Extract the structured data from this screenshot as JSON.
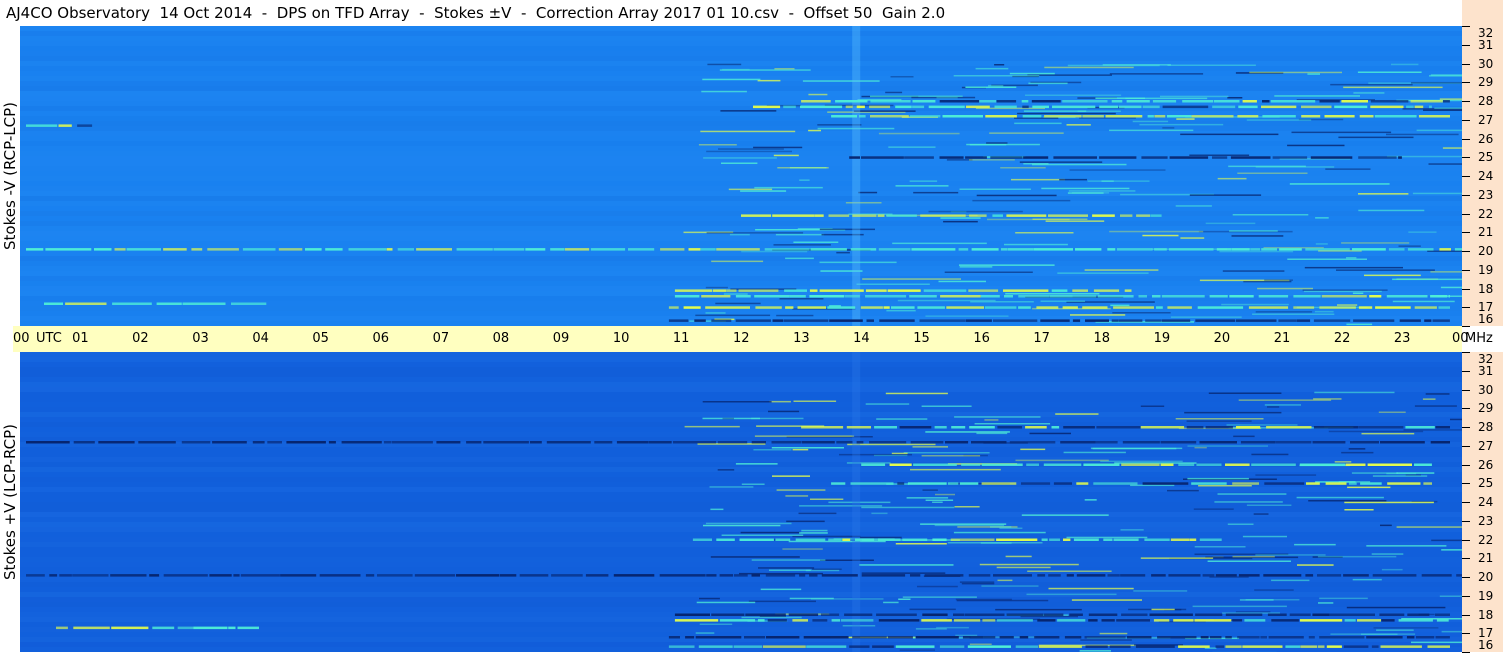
{
  "title": "AJ4CO Observatory  14 Oct 2014  -  DPS on TFD Array  -  Stokes ±V  -  Correction Array 2017 01 10.csv  -  Offset 50  Gain 2.0",
  "colors": {
    "utc_band": "#ffffc0",
    "freq_strip": "#fde3cc",
    "panel_top_base": "#1a82f0",
    "panel_bottom_base": "#1260dc",
    "signal_bright": "#e6ff4a",
    "signal_mid": "#4ff0d6",
    "signal_dark": "#06246e"
  },
  "chart_data": {
    "type": "heatmap",
    "x_axis": {
      "unit_label": "UTC",
      "ticks": [
        "00",
        "01",
        "02",
        "03",
        "04",
        "05",
        "06",
        "07",
        "08",
        "09",
        "10",
        "11",
        "12",
        "13",
        "14",
        "15",
        "16",
        "17",
        "18",
        "19",
        "20",
        "21",
        "22",
        "23",
        "00"
      ],
      "range_hours": [
        0,
        24
      ]
    },
    "y_axis": {
      "unit_label": "MHz",
      "ticks": [
        "32",
        "31",
        "30",
        "29",
        "28",
        "27",
        "26",
        "25",
        "24",
        "23",
        "22",
        "21",
        "20",
        "19",
        "18",
        "17",
        "16"
      ],
      "range_mhz": [
        16,
        32
      ]
    },
    "panels": [
      {
        "label": "Stokes -V (RCP-LCP)",
        "tone": "light",
        "bands": [
          {
            "mhz": 28.0,
            "start": 13.0,
            "end": 23.8,
            "style": "mixed"
          },
          {
            "mhz": 27.7,
            "start": 12.2,
            "end": 23.5,
            "style": "mixed"
          },
          {
            "mhz": 27.2,
            "start": 13.5,
            "end": 23.8,
            "style": "bright"
          },
          {
            "mhz": 26.7,
            "start": 0.1,
            "end": 1.2,
            "style": "mixed"
          },
          {
            "mhz": 25.0,
            "start": 13.8,
            "end": 23.0,
            "style": "dark"
          },
          {
            "mhz": 21.9,
            "start": 12.0,
            "end": 19.0,
            "style": "bright"
          },
          {
            "mhz": 20.1,
            "start": 0.1,
            "end": 24.0,
            "style": "mid"
          },
          {
            "mhz": 17.9,
            "start": 10.9,
            "end": 18.5,
            "style": "bright"
          },
          {
            "mhz": 17.6,
            "start": 10.9,
            "end": 23.8,
            "style": "mid"
          },
          {
            "mhz": 17.2,
            "start": 0.4,
            "end": 4.1,
            "style": "mid"
          },
          {
            "mhz": 17.0,
            "start": 10.8,
            "end": 23.8,
            "style": "bright"
          },
          {
            "mhz": 16.3,
            "start": 10.8,
            "end": 23.8,
            "style": "dark"
          }
        ]
      },
      {
        "label": "Stokes +V (LCP-RCP)",
        "tone": "dark",
        "bands": [
          {
            "mhz": 28.0,
            "start": 13.0,
            "end": 23.8,
            "style": "mixed"
          },
          {
            "mhz": 27.2,
            "start": 0.1,
            "end": 23.8,
            "style": "dark"
          },
          {
            "mhz": 26.0,
            "start": 14.0,
            "end": 23.5,
            "style": "mid"
          },
          {
            "mhz": 25.0,
            "start": 13.5,
            "end": 23.5,
            "style": "mixed"
          },
          {
            "mhz": 22.0,
            "start": 11.2,
            "end": 20.0,
            "style": "mid"
          },
          {
            "mhz": 20.1,
            "start": 0.1,
            "end": 24.0,
            "style": "dark"
          },
          {
            "mhz": 18.0,
            "start": 10.9,
            "end": 23.8,
            "style": "dark"
          },
          {
            "mhz": 17.7,
            "start": 10.9,
            "end": 23.8,
            "style": "mixed"
          },
          {
            "mhz": 17.3,
            "start": 0.6,
            "end": 4.0,
            "style": "bright"
          },
          {
            "mhz": 16.8,
            "start": 10.8,
            "end": 23.8,
            "style": "dark"
          },
          {
            "mhz": 16.3,
            "start": 10.8,
            "end": 23.8,
            "style": "mixed"
          }
        ]
      }
    ]
  }
}
